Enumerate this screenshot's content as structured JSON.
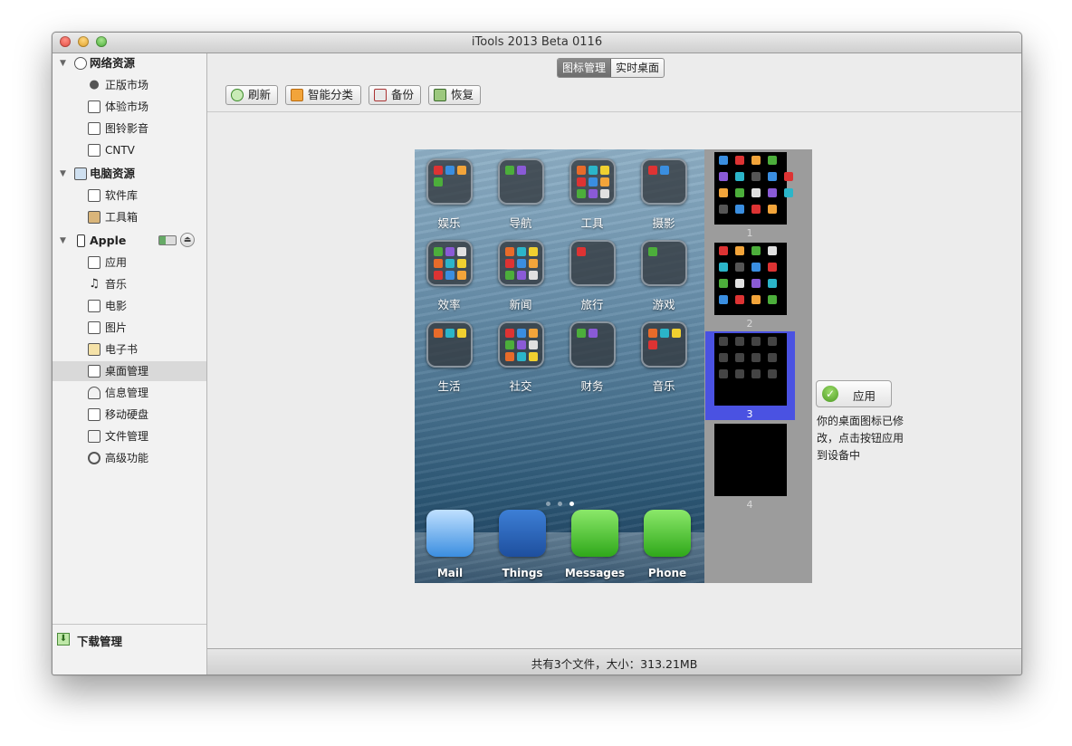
{
  "window": {
    "title": "iTools 2013 Beta 0116"
  },
  "sidebar": {
    "sections": [
      {
        "label": "网络资源",
        "items": [
          "正版市场",
          "体验市场",
          "图铃影音",
          "CNTV"
        ]
      },
      {
        "label": "电脑资源",
        "items": [
          "软件库",
          "工具箱"
        ]
      },
      {
        "label": "Apple",
        "items": [
          "应用",
          "音乐",
          "电影",
          "图片",
          "电子书",
          "桌面管理",
          "信息管理",
          "移动硬盘",
          "文件管理",
          "高级功能"
        ]
      }
    ],
    "active_item": "桌面管理",
    "download": "下载管理"
  },
  "view_switch": {
    "icon_manage": "图标管理",
    "live_desktop": "实时桌面",
    "selected": "图标管理"
  },
  "toolbar": {
    "refresh": "刷新",
    "smart_sort": "智能分类",
    "backup": "备份",
    "restore": "恢复"
  },
  "phone": {
    "folders": [
      "娱乐",
      "导航",
      "工具",
      "摄影",
      "效率",
      "新闻",
      "旅行",
      "游戏",
      "生活",
      "社交",
      "财务",
      "音乐"
    ],
    "page_count": 3,
    "current_page": 3,
    "dock": [
      "Mail",
      "Things",
      "Messages",
      "Phone"
    ]
  },
  "pages": {
    "labels": [
      "1",
      "2",
      "3",
      "4"
    ],
    "selected": "3"
  },
  "apply": {
    "button": "应用",
    "message": "你的桌面图标已修改，点击按钮应用到设备中"
  },
  "status": {
    "text": "共有3个文件，大小：313.21MB"
  },
  "colors": {
    "selection": "#4a52e2",
    "sidebar_active": "#d9d9d9"
  }
}
